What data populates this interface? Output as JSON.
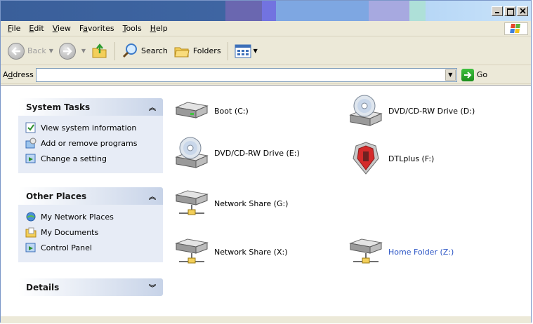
{
  "window": {
    "caption_buttons": [
      "minimize",
      "maximize",
      "close"
    ]
  },
  "menu": {
    "items": [
      {
        "label": "File",
        "accel": "F"
      },
      {
        "label": "Edit",
        "accel": "E"
      },
      {
        "label": "View",
        "accel": "V"
      },
      {
        "label": "Favorites",
        "accel": "a"
      },
      {
        "label": "Tools",
        "accel": "T"
      },
      {
        "label": "Help",
        "accel": "H"
      }
    ]
  },
  "toolbar": {
    "back_label": "Back",
    "search_label": "Search",
    "folders_label": "Folders"
  },
  "address": {
    "label": "Address",
    "value": "",
    "go_label": "Go"
  },
  "panes": {
    "system_tasks": {
      "title": "System Tasks",
      "items": [
        "View system information",
        "Add or remove programs",
        "Change a setting"
      ]
    },
    "other_places": {
      "title": "Other Places",
      "items": [
        "My Network Places",
        "My Documents",
        "Control Panel"
      ]
    },
    "details": {
      "title": "Details"
    }
  },
  "drives": [
    {
      "label": "Boot (C:)",
      "icon": "hard-drive-icon"
    },
    {
      "label": "DVD/CD-RW Drive (D:)",
      "icon": "dvd-drive-icon"
    },
    {
      "label": "DVD/CD-RW Drive (E:)",
      "icon": "dvd-drive-icon"
    },
    {
      "label": "DTLplus (F:)",
      "icon": "usb-drive-icon"
    },
    {
      "label": "Network Share (G:)",
      "icon": "network-drive-icon"
    },
    {
      "label": "Network Share (X:)",
      "icon": "network-drive-icon"
    },
    {
      "label": "Home Folder (Z:)",
      "icon": "network-drive-icon"
    }
  ],
  "colors": {
    "link": "#2a54c5",
    "pane_body": "#e7ecf6"
  }
}
